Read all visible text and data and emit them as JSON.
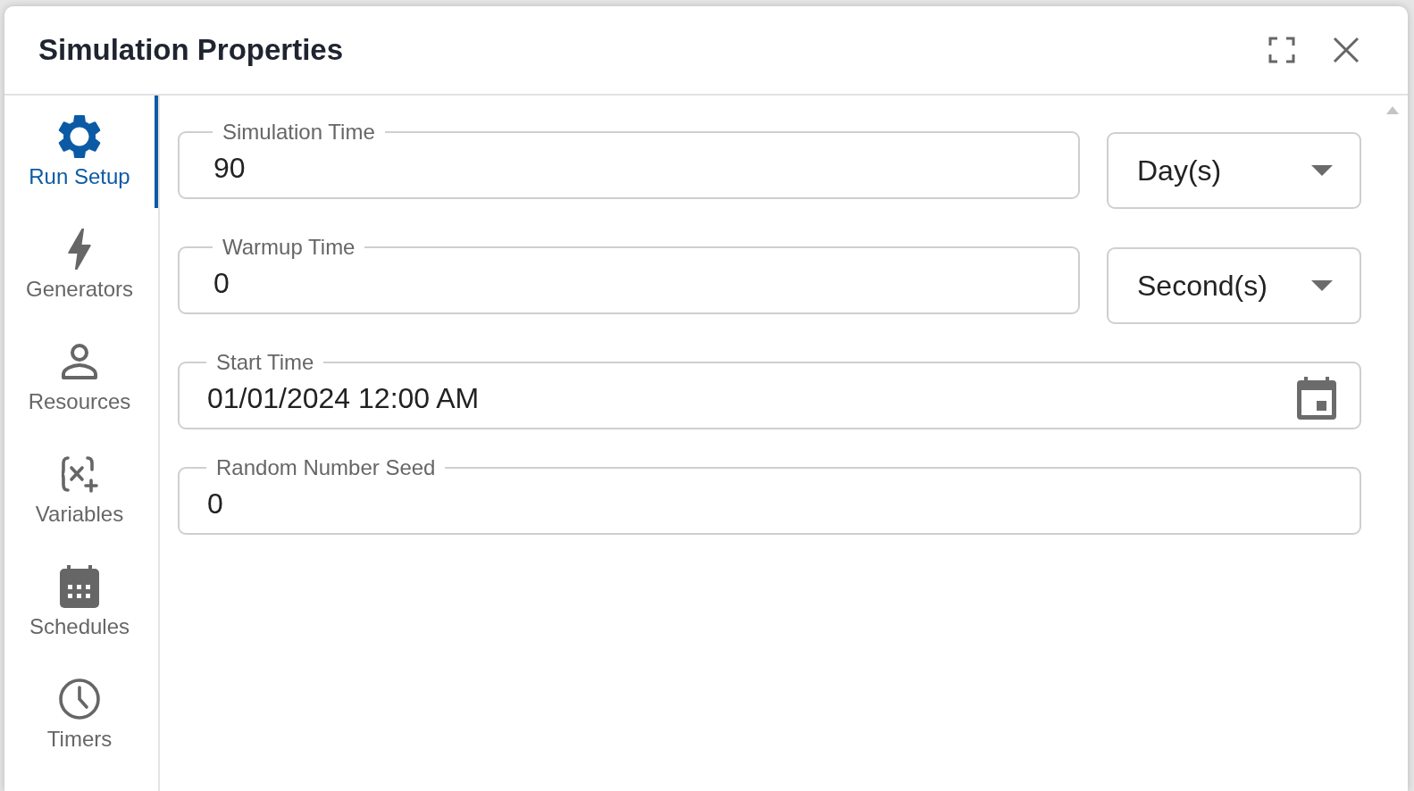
{
  "dialog": {
    "title": "Simulation Properties"
  },
  "sidebar": {
    "items": [
      {
        "kind": "gear",
        "label": "Run Setup",
        "selected": true
      },
      {
        "kind": "bolt",
        "label": "Generators",
        "selected": false
      },
      {
        "kind": "person",
        "label": "Resources",
        "selected": false
      },
      {
        "kind": "variable",
        "label": "Variables",
        "selected": false
      },
      {
        "kind": "calendar",
        "label": "Schedules",
        "selected": false
      },
      {
        "kind": "clock",
        "label": "Timers",
        "selected": false
      }
    ]
  },
  "fields": [
    {
      "kind": "number-with-unit",
      "label": "Simulation Time",
      "value": "90",
      "unit": "Day(s)"
    },
    {
      "kind": "number-with-unit",
      "label": "Warmup Time",
      "value": "0",
      "unit": "Second(s)"
    },
    {
      "kind": "date",
      "label": "Start Time",
      "value": "01/01/2024 12:00 AM"
    },
    {
      "kind": "number",
      "label": "Random Number Seed",
      "value": "0"
    }
  ]
}
